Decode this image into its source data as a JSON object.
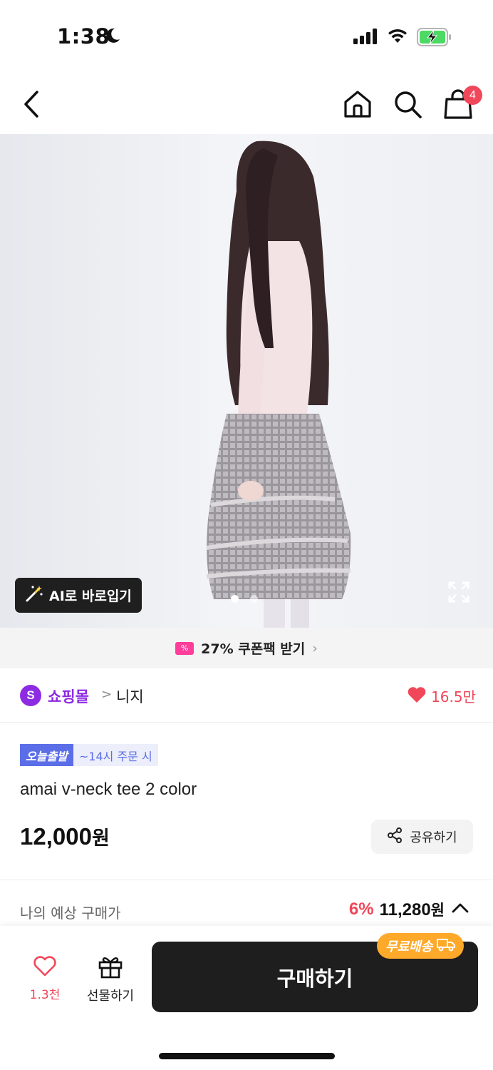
{
  "status_bar": {
    "time": "1:38",
    "icons": [
      "moon-icon",
      "signal-icon",
      "wifi-icon",
      "battery-charging-icon"
    ]
  },
  "nav": {
    "icons": [
      "back-arrow-icon",
      "home-icon",
      "search-icon",
      "shopping-bag-icon"
    ],
    "cart_badge": "4"
  },
  "hero": {
    "ai_button_label": "AI로 바로입기",
    "ai_icon": "magic-wand-icon",
    "expand_icon": "expand-icon",
    "page_dots": 2,
    "active_dot": 0
  },
  "coupon": {
    "icon": "coupon-icon",
    "text": "27% 쿠폰팩 받기",
    "chevron": "›"
  },
  "shop": {
    "logo_letter": "S",
    "name": "쇼핑몰",
    "separator": ">",
    "brand": "니지",
    "likes": "16.5만"
  },
  "product": {
    "badge_today": "오늘출발",
    "badge_time": "~14시 주문 시",
    "name": "amai v-neck tee 2 color",
    "price_number": "12,000",
    "price_unit": "원",
    "share_label": "공유하기"
  },
  "estimate": {
    "label": "나의 예상 구매가",
    "discount": "6%",
    "price_number": "11,280",
    "price_unit": "원"
  },
  "bottom": {
    "wish_count": "1.3천",
    "gift_label": "선물하기",
    "buy_label": "구매하기",
    "free_shipping": "무료배송"
  },
  "colors": {
    "accent_red": "#f0475a",
    "brand_purple": "#8d2be2",
    "badge_blue": "#5b6ee8",
    "shipping_orange": "#ffa92b",
    "buy_button": "#1e1e1e"
  }
}
